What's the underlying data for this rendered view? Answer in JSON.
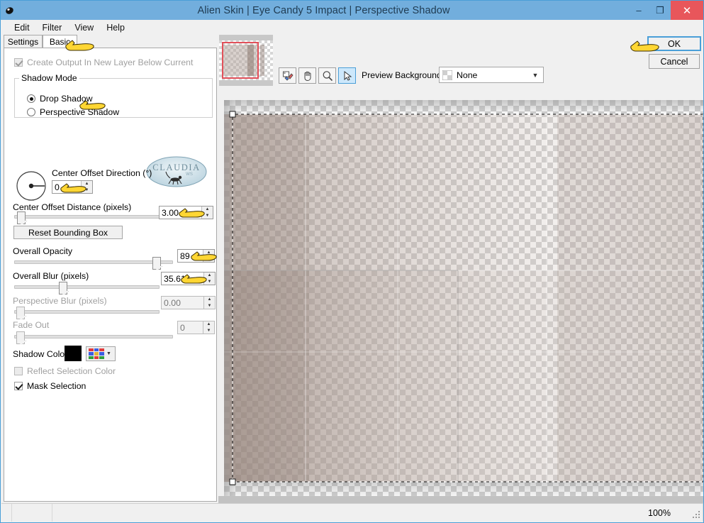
{
  "window": {
    "title": "Alien Skin | Eye Candy 5 Impact | Perspective Shadow",
    "app_icon": "mouse-icon",
    "minimize_label": "–",
    "maximize_label": "❐",
    "close_label": "✕"
  },
  "menubar": {
    "items": [
      {
        "label": "Edit"
      },
      {
        "label": "Filter"
      },
      {
        "label": "View"
      },
      {
        "label": "Help"
      }
    ]
  },
  "tabs": [
    {
      "label": "Settings",
      "selected": false
    },
    {
      "label": "Basic",
      "selected": true
    }
  ],
  "settings": {
    "create_output": {
      "label": "Create Output In New Layer Below Current",
      "checked": true,
      "enabled": false
    },
    "shadow_mode": {
      "legend": "Shadow Mode",
      "options": [
        {
          "label": "Drop Shadow",
          "selected": true
        },
        {
          "label": "Perspective Shadow",
          "selected": false
        }
      ]
    },
    "center_offset_direction": {
      "label": "Center Offset Direction (°)",
      "value": "0",
      "dial_angle_deg": 0
    },
    "center_offset_distance": {
      "label": "Center Offset Distance (pixels)",
      "value": "3.00",
      "slider_pct": 3
    },
    "reset_bounding_box": {
      "label": "Reset Bounding Box"
    },
    "overall_opacity": {
      "label": "Overall Opacity",
      "value": "89",
      "slider_pct": 89
    },
    "overall_blur": {
      "label": "Overall Blur (pixels)",
      "value": "35.61",
      "slider_pct": 24
    },
    "perspective_blur": {
      "label": "Perspective Blur (pixels)",
      "value": "0.00",
      "slider_pct": 2,
      "enabled": false
    },
    "fade_out": {
      "label": "Fade Out",
      "value": "0",
      "slider_pct": 2,
      "enabled": false
    },
    "shadow_color": {
      "label": "Shadow Color",
      "swatch_hex": "#000000",
      "palette_icon": "color-grid-icon",
      "dropdown_icon": "chevron-down-icon"
    },
    "reflect_selection_color": {
      "label": "Reflect Selection Color",
      "checked": false,
      "enabled": false
    },
    "mask_selection": {
      "label": "Mask Selection",
      "checked": true,
      "enabled": true
    }
  },
  "watermark": {
    "text": "CLAUDIA",
    "subtext": "WS"
  },
  "toolbar": {
    "tools": [
      {
        "name": "eyedropper-tool",
        "icon": "eyedropper-icon",
        "active": false
      },
      {
        "name": "hand-tool",
        "icon": "hand-icon",
        "active": false
      },
      {
        "name": "zoom-tool",
        "icon": "magnifier-icon",
        "active": false
      },
      {
        "name": "arrow-tool",
        "icon": "cursor-arrow-icon",
        "active": true
      }
    ],
    "preview_background": {
      "label": "Preview Background:",
      "value": "None",
      "swatch_icon": "checker-swatch-icon",
      "dropdown_icon": "chevron-down-icon"
    }
  },
  "actions": {
    "ok_label": "OK",
    "cancel_label": "Cancel"
  },
  "statusbar": {
    "zoom": "100%",
    "resize_grip": "resize-grip-icon"
  },
  "colors": {
    "titlebar": "#72aedd",
    "close_button": "#e8565b",
    "accent_focus": "#4a9fd8",
    "nav_selection": "#e2515a",
    "panel_bg": "#f0f0f0",
    "shadow_tone": "#a8978f"
  },
  "preview": {
    "zoom_level": "100%",
    "selection_marquee": true,
    "canvas_alpha_checker": true
  }
}
